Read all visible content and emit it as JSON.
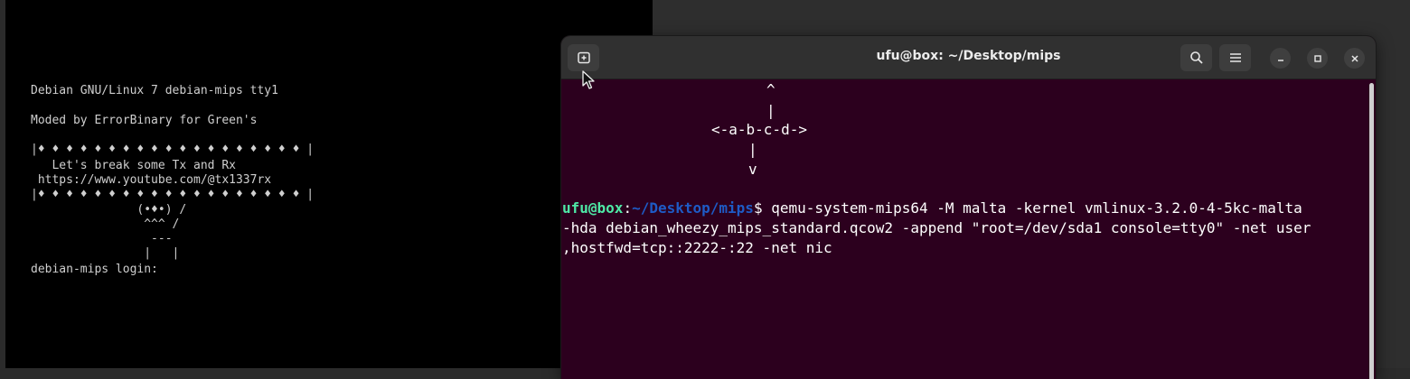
{
  "qemu": {
    "lines": [
      "Debian GNU/Linux 7 debian-mips tty1",
      "Moded by ErrorBinary for Green's",
      "|♦ ♦ ♦ ♦ ♦ ♦ ♦ ♦ ♦ ♦ ♦ ♦ ♦ ♦ ♦ ♦ ♦ ♦ ♦ |",
      "   Let's break some Tx and Rx",
      " https://www.youtube.com/@tx1337rx",
      "|♦ ♦ ♦ ♦ ♦ ♦ ♦ ♦ ♦ ♦ ♦ ♦ ♦ ♦ ♦ ♦ ♦ ♦ ♦ |",
      "               (•♦•) /",
      "                ^^^ /",
      "                 ---",
      "                |   |",
      "debian-mips login:"
    ]
  },
  "terminal": {
    "title": "ufu@box: ~/Desktop/mips",
    "art": [
      "^",
      "|",
      "<-a-b-c-d->",
      "|",
      "v"
    ],
    "prompt_user": "ufu@box",
    "prompt_sep": ":",
    "prompt_path": "~/Desktop/mips",
    "prompt_symbol": "$ ",
    "command_line1": "qemu-system-mips64 -M malta -kernel vmlinux-3.2.0-4-5kc-malta",
    "command_line2": "-hda debian_wheezy_mips_standard.qcow2 -append \"root=/dev/sda1 console=tty0\" -net user",
    "command_line3": ",hostfwd=tcp::2222-:22 -net nic"
  },
  "colors": {
    "terminal_bg": "#2c001e",
    "prompt_user": "#4ee9a6",
    "prompt_path": "#1e5bc6"
  },
  "icons": [
    "new-tab-icon",
    "search-icon",
    "hamburger-menu-icon",
    "minimize-icon",
    "maximize-icon",
    "close-icon",
    "mouse-pointer-icon"
  ]
}
